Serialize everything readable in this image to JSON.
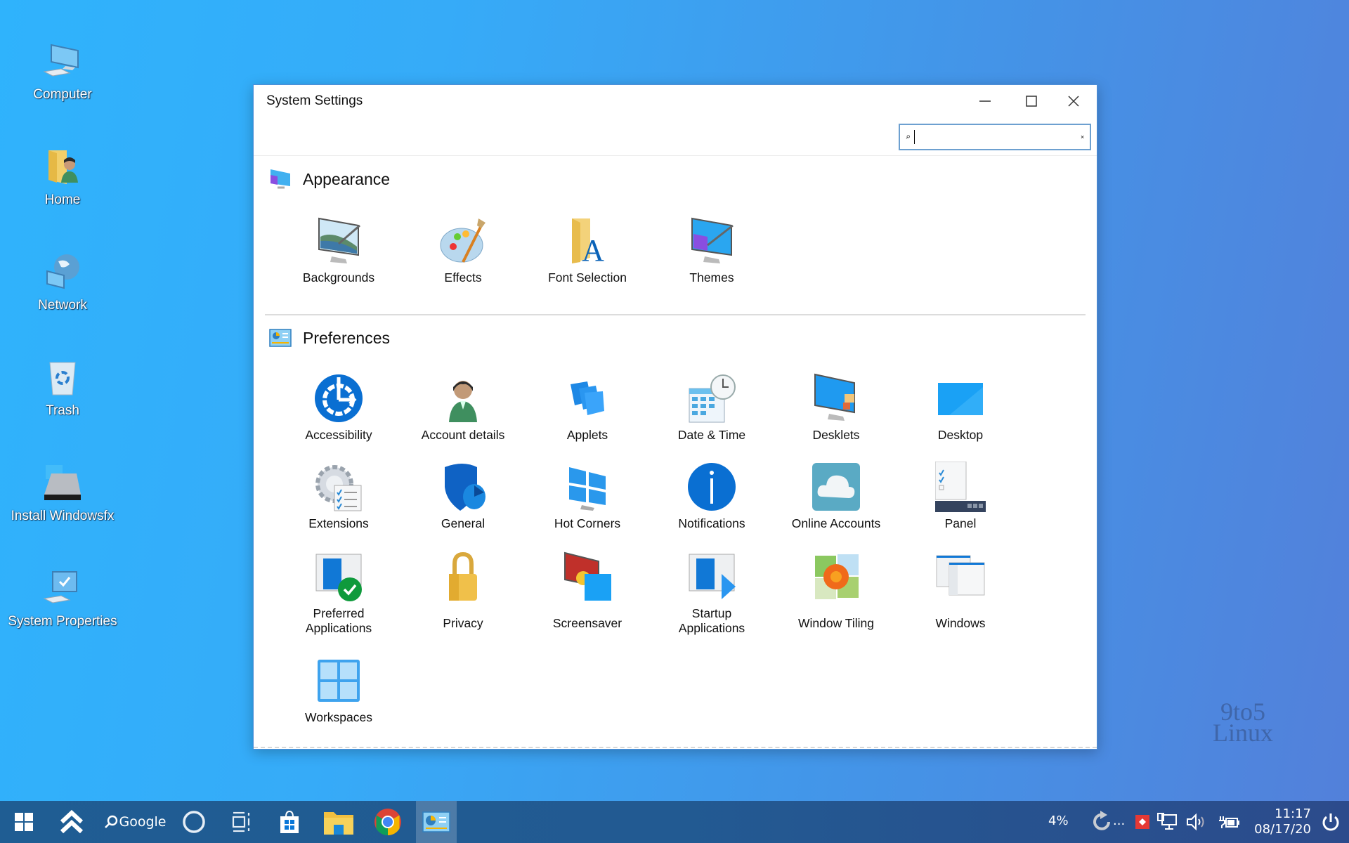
{
  "desktop": {
    "icons": [
      {
        "label": "Computer",
        "icon": "computer-icon"
      },
      {
        "label": "Home",
        "icon": "home-folder-icon"
      },
      {
        "label": "Network",
        "icon": "network-icon"
      },
      {
        "label": "Trash",
        "icon": "trash-icon"
      },
      {
        "label": "Install Windowsfx",
        "icon": "install-drive-icon"
      },
      {
        "label": "System Properties",
        "icon": "system-properties-icon"
      }
    ],
    "watermark": {
      "line1": "9to5",
      "line2": "Linux"
    }
  },
  "window": {
    "title": "System Settings",
    "controls": {
      "minimize": "minimize-icon",
      "maximize": "maximize-icon",
      "close": "close-icon"
    },
    "search": {
      "value": "",
      "placeholder": ""
    },
    "sections": [
      {
        "title": "Appearance",
        "items": [
          {
            "label": "Backgrounds"
          },
          {
            "label": "Effects"
          },
          {
            "label": "Font Selection"
          },
          {
            "label": "Themes"
          }
        ]
      },
      {
        "title": "Preferences",
        "items": [
          {
            "label": "Accessibility"
          },
          {
            "label": "Account details"
          },
          {
            "label": "Applets"
          },
          {
            "label": "Date & Time"
          },
          {
            "label": "Desklets"
          },
          {
            "label": "Desktop"
          },
          {
            "label": "Extensions"
          },
          {
            "label": "General"
          },
          {
            "label": "Hot Corners"
          },
          {
            "label": "Notifications"
          },
          {
            "label": "Online Accounts"
          },
          {
            "label": "Panel"
          },
          {
            "label_line1": "Preferred",
            "label_line2": "Applications"
          },
          {
            "label": "Privacy"
          },
          {
            "label": "Screensaver"
          },
          {
            "label_line1": "Startup",
            "label_line2": "Applications"
          },
          {
            "label": "Window Tiling"
          },
          {
            "label": "Windows"
          },
          {
            "label": "Workspaces"
          }
        ]
      }
    ]
  },
  "taskbar": {
    "search_label": "Google",
    "tray": {
      "cpu": "4%",
      "overflow": "...",
      "time": "11:17",
      "date": "08/17/20"
    }
  },
  "colors": {
    "accent": "#0a6fd2",
    "taskbar": "#225a92",
    "window_border": "#4f8fd8"
  }
}
